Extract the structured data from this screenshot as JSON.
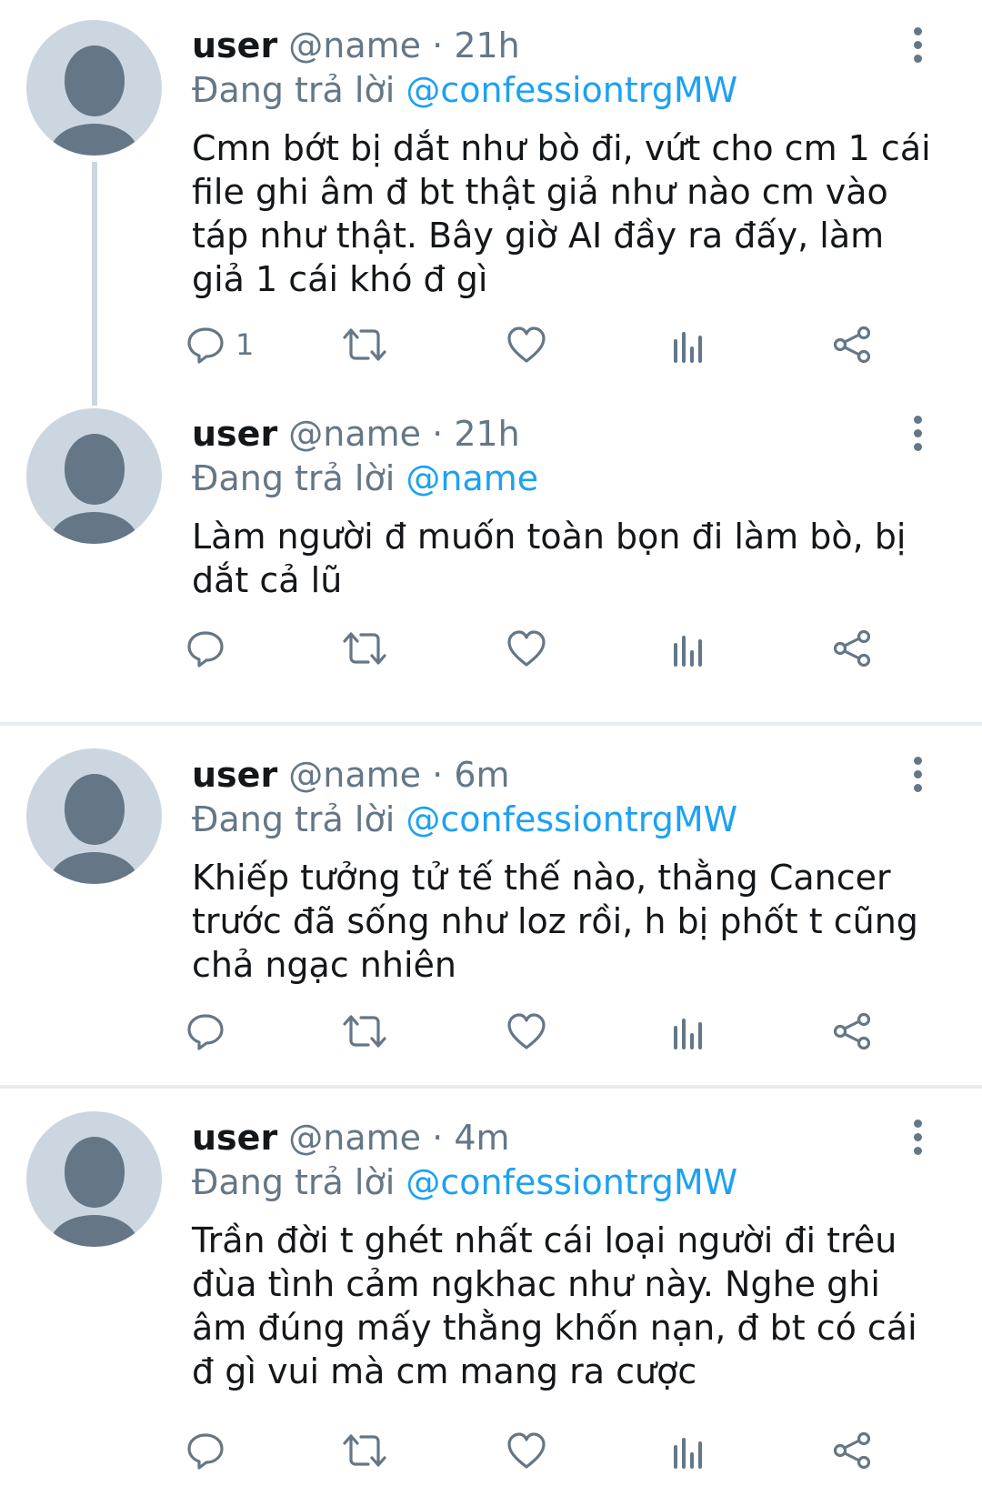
{
  "colors": {
    "text": "#14171a",
    "secondary": "#657786",
    "link": "#1da1f2",
    "avatar_bg": "#ccd6e0",
    "divider": "#e6ecf0"
  },
  "reply_prefix": "Đang trả lời",
  "tweets": [
    {
      "display_name": "user",
      "handle": "@name",
      "time": "21h",
      "reply_to": "@confessiontrgMW",
      "text": "Cmn bớt bị dắt như bò đi, vứt cho cm 1 cái\nfile ghi âm đ bt thật giả như nào cm vào\ntáp như thật. Bây giờ AI đầy ra đấy, làm\ngiả 1 cái khó đ gì",
      "reply_count": "1"
    },
    {
      "display_name": "user",
      "handle": "@name",
      "time": "21h",
      "reply_to": "@name",
      "text": "Làm người đ muốn toàn bọn đi làm bò, bị\ndắt cả lũ",
      "reply_count": ""
    },
    {
      "display_name": "user",
      "handle": "@name",
      "time": "6m",
      "reply_to": "@confessiontrgMW",
      "text": "Khiếp tưởng tử tế thế nào, thằng Cancer\ntrước đã sống như loz rồi, h bị phốt t cũng\nchả ngạc nhiên",
      "reply_count": ""
    },
    {
      "display_name": "user",
      "handle": "@name",
      "time": "4m",
      "reply_to": "@confessiontrgMW",
      "text": "Trần đời t ghét nhất cái loại người đi trêu\nđùa tình cảm ngkhac như này. Nghe ghi\nâm đúng mấy thằng khốn nạn, đ bt có cái\nđ gì vui mà cm mang ra cược",
      "reply_count": ""
    }
  ],
  "action_icons": [
    "reply-icon",
    "retweet-icon",
    "like-icon",
    "analytics-icon",
    "share-icon"
  ],
  "menu_icon": "more-vertical-icon"
}
